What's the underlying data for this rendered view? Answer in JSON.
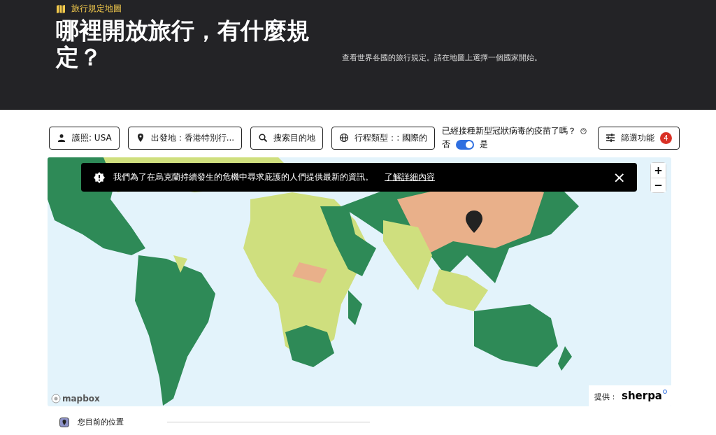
{
  "header": {
    "eyebrow": "旅行規定地圖",
    "title": "哪裡開放旅行，有什麼規定？",
    "subtitle": "查看世界各國的旅行規定。請在地圖上選擇一個國家開始。"
  },
  "filters": [
    {
      "kind": "passport",
      "label": "護照: USA"
    },
    {
      "kind": "origin",
      "label": "出發地：香港特別行..."
    },
    {
      "kind": "search",
      "label": "搜索目的地"
    },
    {
      "kind": "trip",
      "label": "行程類型：: 國際的"
    }
  ],
  "vaccine": {
    "question": "已經接種新型冠狀病毒的疫苗了嗎？",
    "off_label": "否",
    "on_label": "是",
    "on": true
  },
  "filter_button": {
    "label": "篩選功能",
    "count": "4"
  },
  "banner": {
    "message": "我們為了在烏克蘭持續發生的危機中尋求庇護的人們提供最新的資訊。",
    "link": "了解詳細內容",
    "close": "×"
  },
  "map": {
    "zoom_in": "+",
    "zoom_out": "−",
    "logo_text": "mapbox",
    "credit_label": "提供：",
    "credit_brand": "sherpa"
  },
  "legend": {
    "label": "您目前的位置"
  }
}
